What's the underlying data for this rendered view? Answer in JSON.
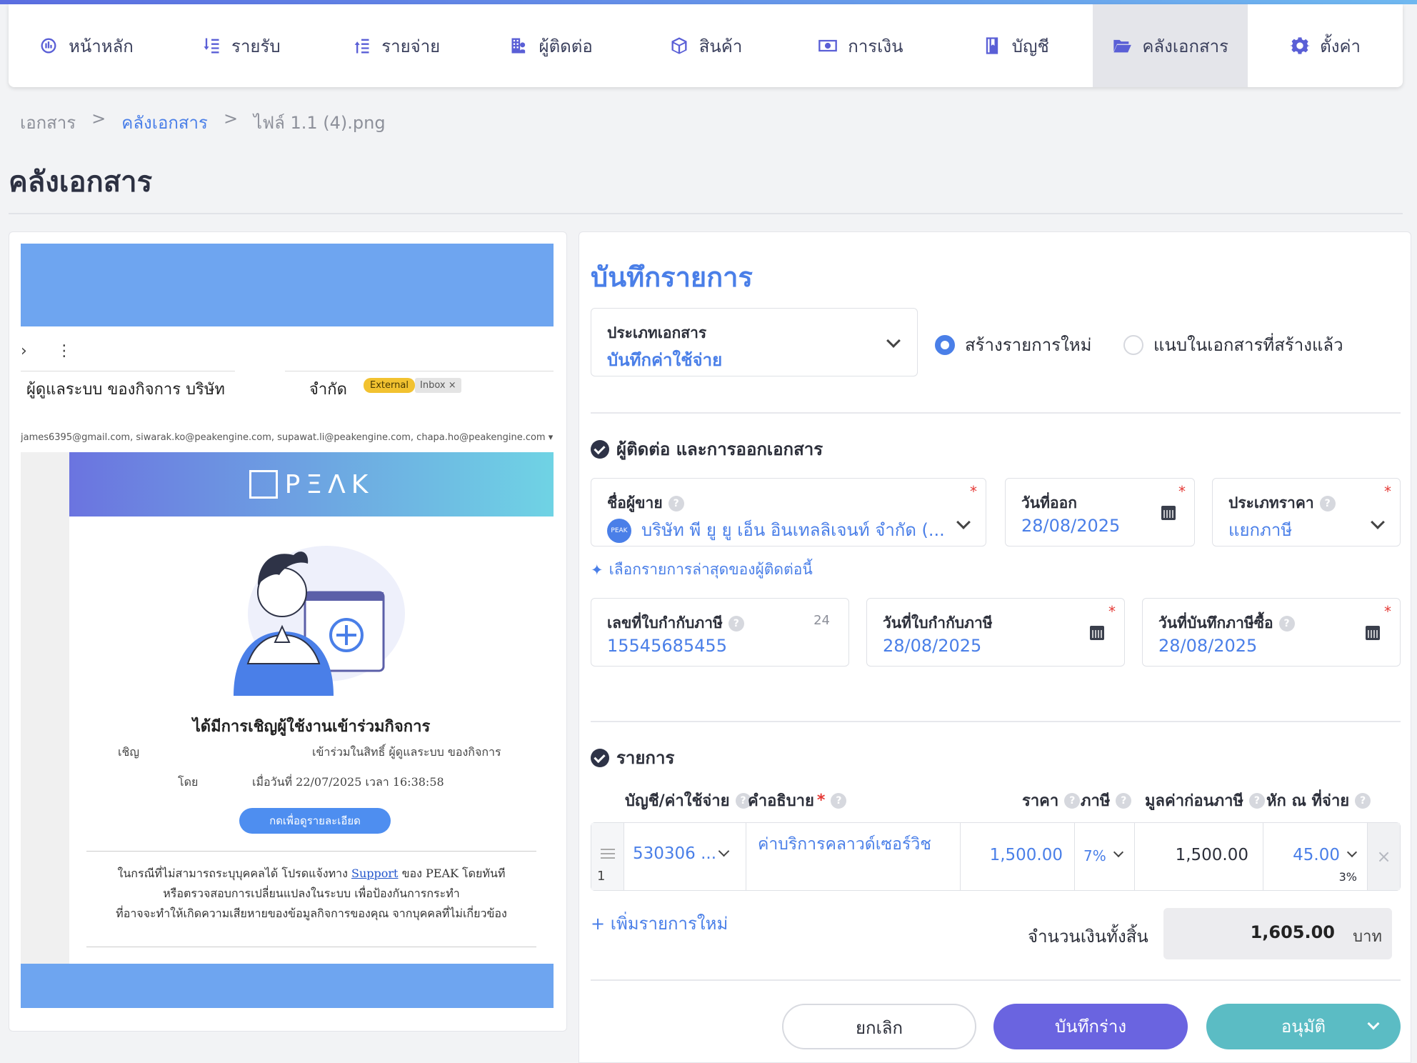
{
  "nav": {
    "items": [
      {
        "label": "หน้าหลัก",
        "icon": "dashboard-icon"
      },
      {
        "label": "รายรับ",
        "icon": "income-list-icon"
      },
      {
        "label": "รายจ่าย",
        "icon": "expense-list-icon"
      },
      {
        "label": "ผู้ติดต่อ",
        "icon": "contacts-icon"
      },
      {
        "label": "สินค้า",
        "icon": "box-icon"
      },
      {
        "label": "การเงิน",
        "icon": "money-icon"
      },
      {
        "label": "บัญชี",
        "icon": "book-icon"
      },
      {
        "label": "คลังเอกสาร",
        "icon": "folder-open-icon",
        "active": true
      },
      {
        "label": "ตั้งค่า",
        "icon": "gear-icon"
      }
    ]
  },
  "breadcrumb": {
    "items": [
      "เอกสาร",
      ">",
      "คลังเอกสาร",
      ">",
      "ไฟล์ 1.1 (4).png"
    ]
  },
  "page": {
    "title": "คลังเอกสาร"
  },
  "preview": {
    "subject_left": "ผู้ดูแลระบบ ของกิจการ บริษัท",
    "subject_right": "จำกัด",
    "badge_external": "External",
    "badge_inbox": "Inbox ×",
    "emails": "james6395@gmail.com, siwarak.ko@peakengine.com, supawat.li@peakengine.com, chapa.ho@peakengine.com ▾",
    "brand": "PΞΛK",
    "invite_title": "ได้มีการเชิญผู้ใช้งานเข้าร่วมกิจการ",
    "invite_label": "เชิญ",
    "invite_text": "เข้าร่วมในสิทธิ์ ผู้ดูแลระบบ ของกิจการ",
    "by_label": "โดย",
    "by_text": "เมื่อวันที่ 22/07/2025 เวลา 16:38:58",
    "details_button": "กดเพื่อดูรายละเอียด",
    "footer_line1_a": "ในกรณีที่ไม่สามารถระบุบุคคลได้ โปรดแจ้งทาง ",
    "footer_support": "Support",
    "footer_line1_b": " ของ PEAK โดยทันที",
    "footer_line2": "หรือตรวจสอบการเปลี่ยนแปลงในระบบ เพื่อป้องกันการกระทำ",
    "footer_line3": "ที่อาจจะทำให้เกิดความเสียหายของข้อมูลกิจการของคุณ จากบุคคลที่ไม่เกี่ยวข้อง"
  },
  "form": {
    "title": "บันทึกรายการ",
    "doc_type": {
      "label": "ประเภทเอกสาร",
      "value": "บันทึกค่าใช้จ่าย"
    },
    "radio_new": "สร้างรายการใหม่",
    "radio_attach": "แนบในเอกสารที่สร้างแล้ว",
    "section_contact": "ผู้ติดต่อ และการออกเอกสาร",
    "seller": {
      "label": "ชื่อผู้ขาย",
      "value": "บริษัท พี ยู ยู เอ็น อินเทลลิเจนท์ จำกัด (...",
      "avatar": "PEAK"
    },
    "issue_date": {
      "label": "วันที่ออก",
      "value": "28/08/2025"
    },
    "price_type": {
      "label": "ประเภทราคา",
      "value": "แยกภาษี"
    },
    "latest_link": "เลือกรายการล่าสุดของผู้ติดต่อนี้",
    "tax_invoice_no": {
      "label": "เลขที่ใบกำกับภาษี",
      "value": "15545685455",
      "counter": "24"
    },
    "tax_invoice_date": {
      "label": "วันที่ใบกำกับภาษี",
      "value": "28/08/2025"
    },
    "purchase_tax_date": {
      "label": "วันที่บันทึกภาษีซื้อ",
      "value": "28/08/2025"
    },
    "section_items": "รายการ",
    "columns": {
      "account": "บัญชี/ค่าใช้จ่าย",
      "description": "คำอธิบาย",
      "price": "ราคา",
      "tax": "ภาษี",
      "pretax": "มูลค่าก่อนภาษี",
      "withholding": "หัก ณ ที่จ่าย"
    },
    "line_items": [
      {
        "no": "1",
        "account": "530306 ...",
        "description": "ค่าบริการคลาวด์เซอร์วิช",
        "price": "1,500.00",
        "tax": "7%",
        "pretax": "1,500.00",
        "withholding": "45.00",
        "withholding_rate": "3%"
      }
    ],
    "add_line": "+ เพิ่มรายการใหม่",
    "total_label": "จำนวนเงินทั้งสิ้น",
    "total_value": "1,605.00",
    "currency": "บาท",
    "buttons": {
      "cancel": "ยกเลิก",
      "draft": "บันทึกร่าง",
      "approve": "อนุมัติ"
    }
  },
  "colors": {
    "accent": "#4a7fe8",
    "draft": "#6a64e0",
    "approve": "#5bbcc4",
    "required": "#e53935"
  }
}
